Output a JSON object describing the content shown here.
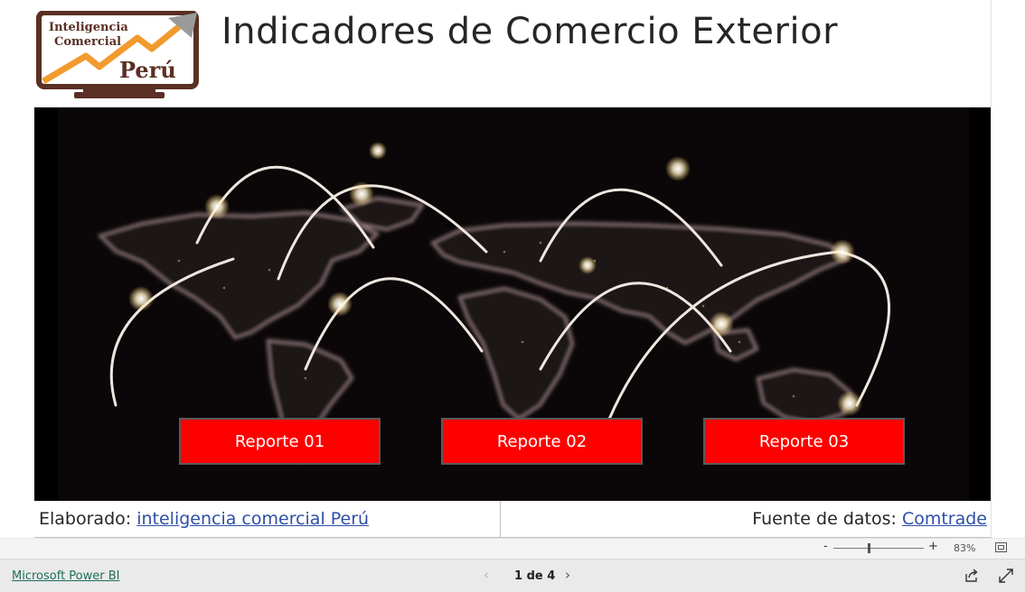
{
  "header": {
    "logo": {
      "line1": "Inteligencia",
      "line2": "Comercial",
      "line3": "Perú"
    },
    "title": "Indicadores de Comercio Exterior"
  },
  "hero": {
    "image": "world-trade-network-map",
    "buttons": [
      {
        "label": "Reporte 01"
      },
      {
        "label": "Reporte 02"
      },
      {
        "label": "Reporte 03"
      }
    ]
  },
  "footer": {
    "credit_prefix": "Elaborado: ",
    "credit_link": "inteligencia comercial Perú",
    "source_prefix": "Fuente de datos: ",
    "source_link": "Comtrade"
  },
  "zoom": {
    "minus": "-",
    "plus": "+",
    "level": "83%"
  },
  "statusbar": {
    "brand": "Microsoft Power BI",
    "page_indicator": "1 de 4",
    "prev": "‹",
    "next": "›"
  },
  "colors": {
    "button_red": "#ff0000",
    "logo_brown": "#5a2f24",
    "logo_orange": "#f29a2e",
    "link_blue": "#2d4fa8"
  }
}
